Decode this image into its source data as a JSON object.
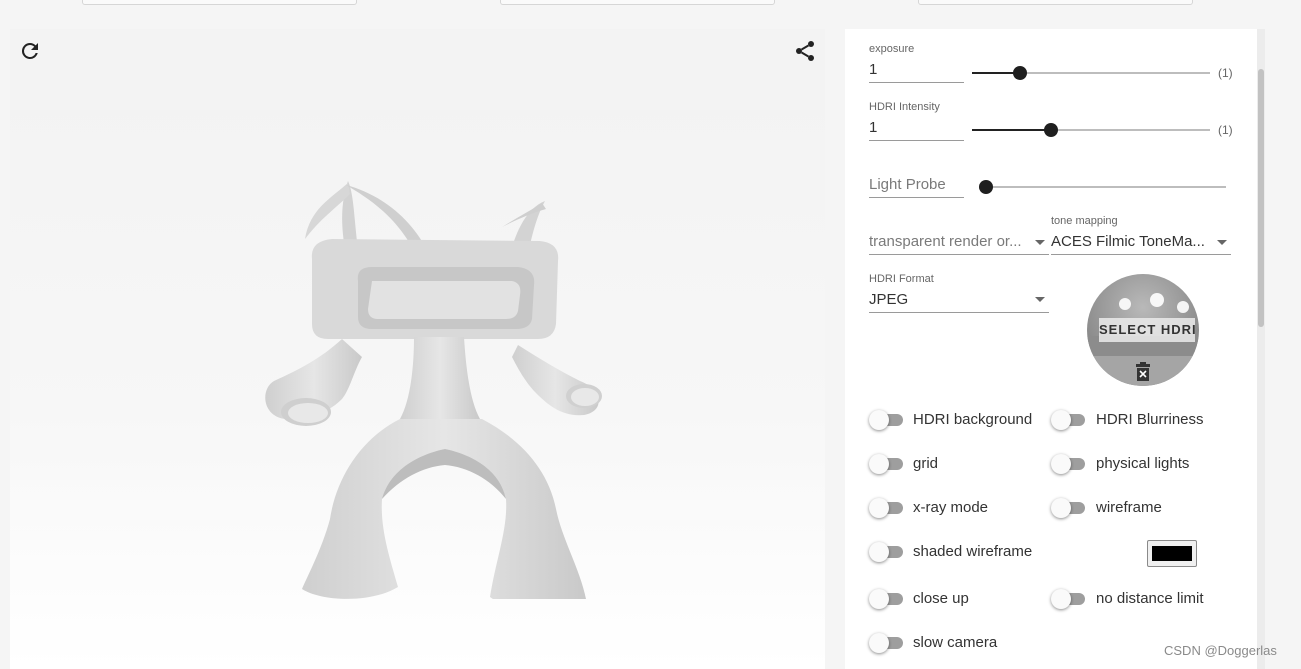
{
  "viewer": {
    "reload_icon": "refresh-icon",
    "share_icon": "share-icon"
  },
  "panel": {
    "exposure": {
      "label": "exposure",
      "value": "1",
      "note": "(1)",
      "level": 0.2
    },
    "hdri_intensity": {
      "label": "HDRI Intensity",
      "value": "1",
      "note": "(1)",
      "level": 0.33
    },
    "light_probe": {
      "placeholder": "Light Probe",
      "level": 0.0
    },
    "transparent_render": {
      "placeholder": "transparent render or..."
    },
    "tone_mapping": {
      "label": "tone mapping",
      "value": "ACES Filmic ToneMa..."
    },
    "hdri_format": {
      "label": "HDRI Format",
      "value": "JPEG"
    },
    "select_hdri": {
      "label": "SELECT HDRI",
      "delete_icon": "trash-icon"
    },
    "toggles": [
      {
        "id": "hdri-background",
        "label": "HDRI background",
        "on": false
      },
      {
        "id": "hdri-blurriness",
        "label": "HDRI Blurriness",
        "on": false
      },
      {
        "id": "grid",
        "label": "grid",
        "on": false
      },
      {
        "id": "physical-lights",
        "label": "physical lights",
        "on": false
      },
      {
        "id": "x-ray-mode",
        "label": "x-ray mode",
        "on": false
      },
      {
        "id": "wireframe",
        "label": "wireframe",
        "on": false
      },
      {
        "id": "shaded-wireframe",
        "label": "shaded wireframe",
        "on": false
      },
      {
        "id": "close-up",
        "label": "close up",
        "on": false
      },
      {
        "id": "no-distance-limit",
        "label": "no distance limit",
        "on": false
      },
      {
        "id": "slow-camera",
        "label": "slow camera",
        "on": false
      }
    ],
    "wireframe_color": "#000000"
  },
  "watermark": "CSDN @Doggerlas"
}
